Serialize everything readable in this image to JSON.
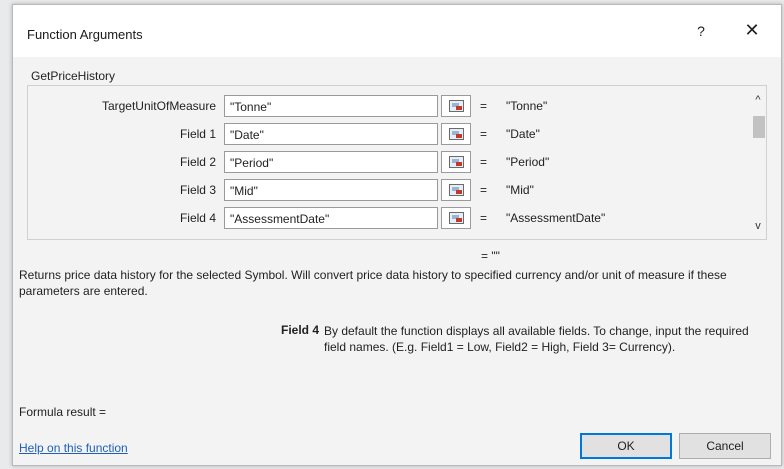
{
  "dialog": {
    "title": "Function Arguments",
    "help_glyph": "?",
    "close_glyph": "✕"
  },
  "function_name": "GetPriceHistory",
  "arguments": [
    {
      "label": "TargetUnitOfMeasure",
      "value": "\"Tonne\"",
      "result": "\"Tonne\""
    },
    {
      "label": "Field 1",
      "value": "\"Date\"",
      "result": "\"Date\""
    },
    {
      "label": "Field 2",
      "value": "\"Period\"",
      "result": "\"Period\""
    },
    {
      "label": "Field 3",
      "value": "\"Mid\"",
      "result": "\"Mid\""
    },
    {
      "label": "Field 4",
      "value": "\"AssessmentDate\"",
      "result": "\"AssessmentDate\""
    }
  ],
  "equals_sign": "=",
  "overall_result": "= \"\"",
  "description": "Returns price data history for the selected Symbol. Will convert price data history to specified currency and/or unit of measure if these parameters are entered.",
  "field_help": {
    "label": "Field 4",
    "text": "By default the function displays all available fields. To change, input the required field names. (E.g. Field1 = Low, Field2 = High, Field 3= Currency)."
  },
  "formula_result_label": "Formula result =",
  "help_link": "Help on this function",
  "buttons": {
    "ok": "OK",
    "cancel": "Cancel"
  },
  "scroll_glyphs": {
    "up": "^",
    "down": "v"
  }
}
